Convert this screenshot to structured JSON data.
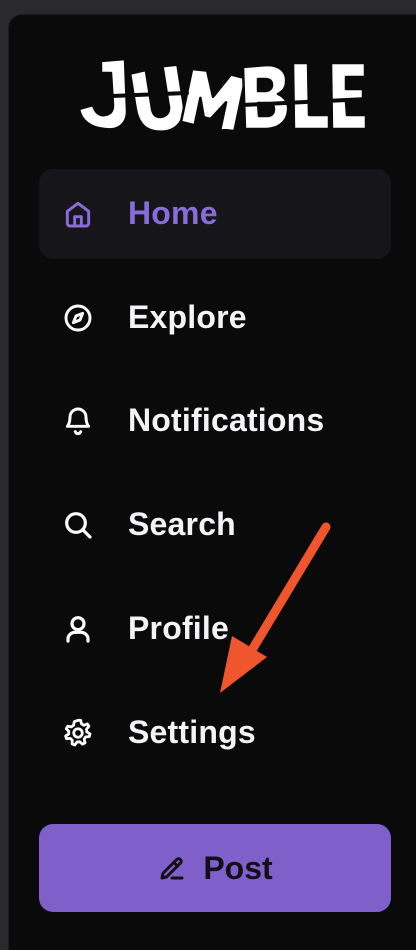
{
  "logo": {
    "text": "JUMBLE"
  },
  "nav": {
    "items": [
      {
        "label": "Home",
        "icon": "home-icon",
        "active": true
      },
      {
        "label": "Explore",
        "icon": "compass-icon",
        "active": false
      },
      {
        "label": "Notifications",
        "icon": "bell-icon",
        "active": false
      },
      {
        "label": "Search",
        "icon": "search-icon",
        "active": false
      },
      {
        "label": "Profile",
        "icon": "user-icon",
        "active": false
      },
      {
        "label": "Settings",
        "icon": "gear-icon",
        "active": false
      }
    ]
  },
  "post": {
    "label": "Post",
    "icon": "pencil-icon"
  },
  "colors": {
    "accent": "#7f5fc9",
    "active_text": "#8a6cd8",
    "annotation_arrow": "#f0562e"
  }
}
